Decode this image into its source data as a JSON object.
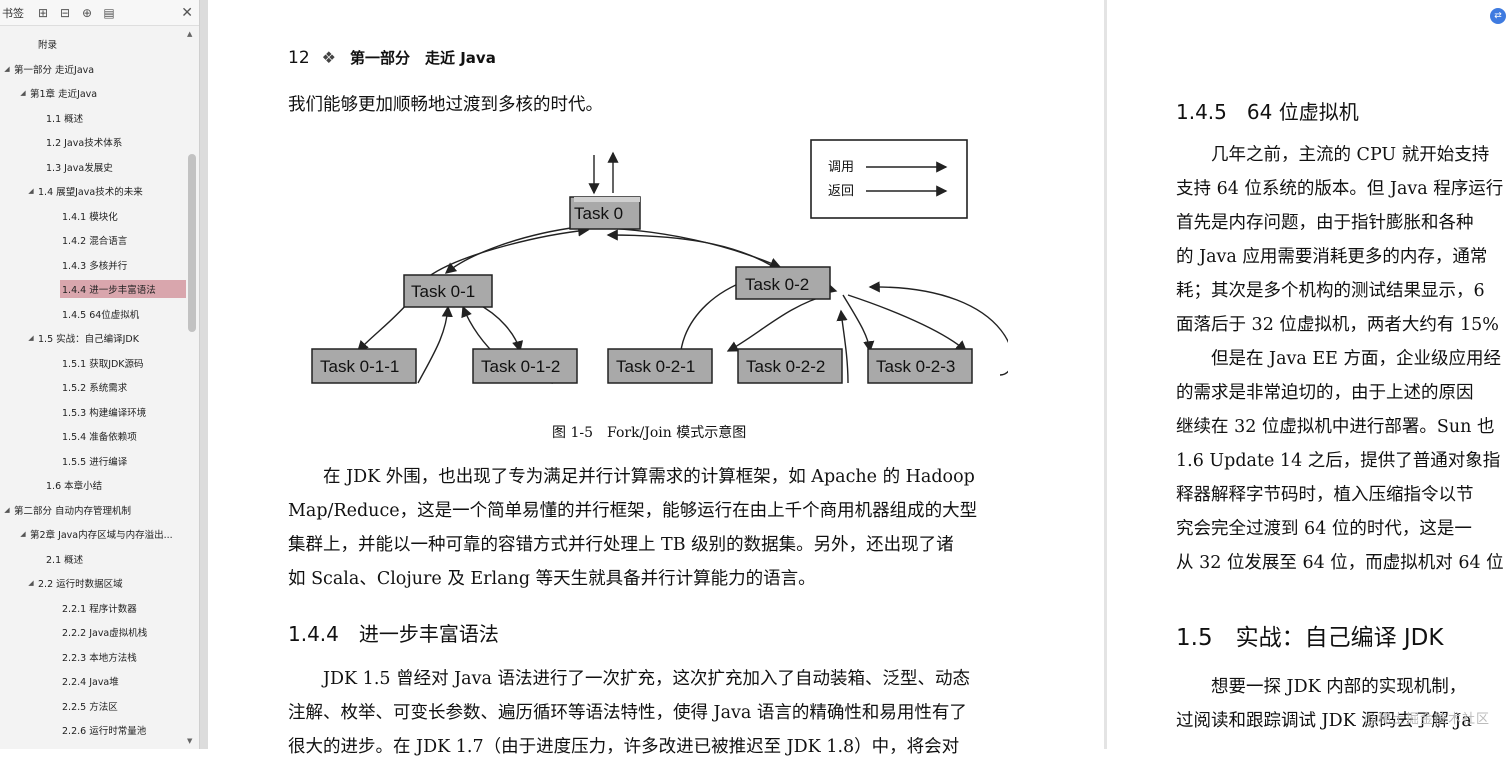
{
  "sidebar": {
    "title": "书签",
    "tree": [
      {
        "label": "附录",
        "level": 2,
        "toggle": ""
      },
      {
        "label": "第一部分 走近Java",
        "level": 0,
        "toggle": "◢"
      },
      {
        "label": "第1章 走近Java",
        "level": 1,
        "toggle": "◢"
      },
      {
        "label": "1.1 概述",
        "level": 3,
        "toggle": ""
      },
      {
        "label": "1.2 Java技术体系",
        "level": 3,
        "toggle": ""
      },
      {
        "label": "1.3 Java发展史",
        "level": 3,
        "toggle": ""
      },
      {
        "label": "1.4 展望Java技术的未来",
        "level": 2,
        "toggle": "◢"
      },
      {
        "label": "1.4.1 模块化",
        "level": 4,
        "toggle": ""
      },
      {
        "label": "1.4.2 混合语言",
        "level": 4,
        "toggle": ""
      },
      {
        "label": "1.4.3 多核并行",
        "level": 4,
        "toggle": ""
      },
      {
        "label": "1.4.4 进一步丰富语法",
        "level": 4,
        "toggle": "",
        "selected": true
      },
      {
        "label": "1.4.5 64位虚拟机",
        "level": 4,
        "toggle": ""
      },
      {
        "label": "1.5 实战：自己编译JDK",
        "level": 2,
        "toggle": "◢"
      },
      {
        "label": "1.5.1 获取JDK源码",
        "level": 4,
        "toggle": ""
      },
      {
        "label": "1.5.2 系统需求",
        "level": 4,
        "toggle": ""
      },
      {
        "label": "1.5.3 构建编译环境",
        "level": 4,
        "toggle": ""
      },
      {
        "label": "1.5.4 准备依赖项",
        "level": 4,
        "toggle": ""
      },
      {
        "label": "1.5.5 进行编译",
        "level": 4,
        "toggle": ""
      },
      {
        "label": "1.6 本章小结",
        "level": 3,
        "toggle": ""
      },
      {
        "label": "第二部分 自动内存管理机制",
        "level": 0,
        "toggle": "◢"
      },
      {
        "label": "第2章 Java内存区域与内存溢出...",
        "level": 1,
        "toggle": "◢"
      },
      {
        "label": "2.1 概述",
        "level": 3,
        "toggle": ""
      },
      {
        "label": "2.2 运行时数据区域",
        "level": 2,
        "toggle": "◢"
      },
      {
        "label": "2.2.1 程序计数器",
        "level": 4,
        "toggle": ""
      },
      {
        "label": "2.2.2 Java虚拟机栈",
        "level": 4,
        "toggle": ""
      },
      {
        "label": "2.2.3 本地方法栈",
        "level": 4,
        "toggle": ""
      },
      {
        "label": "2.2.4 Java堆",
        "level": 4,
        "toggle": ""
      },
      {
        "label": "2.2.5 方法区",
        "level": 4,
        "toggle": ""
      },
      {
        "label": "2.2.6 运行时常量池",
        "level": 4,
        "toggle": ""
      }
    ]
  },
  "page_left": {
    "page_number": "12",
    "part_title": "第一部分　走近 Java",
    "intro": "我们能够更加顺畅地过渡到多核的时代。",
    "figure": {
      "legend_call": "调用",
      "legend_return": "返回",
      "nodes": [
        "Task 0",
        "Task 0-1",
        "Task 0-2",
        "Task 0-1-1",
        "Task 0-1-2",
        "Task 0-2-1",
        "Task 0-2-2",
        "Task 0-2-3"
      ],
      "caption": "图 1-5　Fork/Join 模式示意图"
    },
    "para1": [
      "　　在 JDK 外围，也出现了专为满足并行计算需求的计算框架，如 Apache 的 Hadoop",
      "Map/Reduce，这是一个简单易懂的并行框架，能够运行在由上千个商用机器组成的大型",
      "集群上，并能以一种可靠的容错方式并行处理上 TB 级别的数据集。另外，还出现了诸",
      "如 Scala、Clojure 及 Erlang 等天生就具备并行计算能力的语言。"
    ],
    "section_title": "1.4.4　进一步丰富语法",
    "para2": [
      "　　JDK 1.5 曾经对 Java 语法进行了一次扩充，这次扩充加入了自动装箱、泛型、动态",
      "注解、枚举、可变长参数、遍历循环等语法特性，使得 Java 语言的精确性和易用性有了",
      "很大的进步。在 JDK 1.7（由于进度压力，许多改进已被推迟至 JDK 1.8）中，将会对"
    ]
  },
  "page_right": {
    "section_title": "1.4.5　64 位虚拟机",
    "lines": [
      "　　几年之前，主流的 CPU 就开始支持",
      "支持 64 位系统的版本。但 Java 程序运行",
      "首先是内存问题，由于指针膨胀和各种",
      "的 Java 应用需要消耗更多的内存，通常",
      "耗；其次是多个机构的测试结果显示，6",
      "面落后于 32 位虚拟机，两者大约有 15%",
      "　　但是在 Java EE 方面，企业级应用经",
      "的需求是非常迫切的，由于上述的原因",
      "继续在 32 位虚拟机中进行部署。Sun 也",
      "1.6 Update 14 之后，提供了普通对象指",
      "释器解释字节码时，植入压缩指令以节",
      "究会完全过渡到 64 位的时代，这是一",
      "从 32 位发展至 64 位，而虚拟机对 64 位"
    ],
    "chapter_title": "1.5　实战：自己编译 JDK",
    "foot_lines": [
      "　　想要一探 JDK 内部的实现机制，",
      "过阅读和跟踪调试 JDK 源码去了解 Ja"
    ],
    "watermark": "@稀土掘金技术社区"
  }
}
